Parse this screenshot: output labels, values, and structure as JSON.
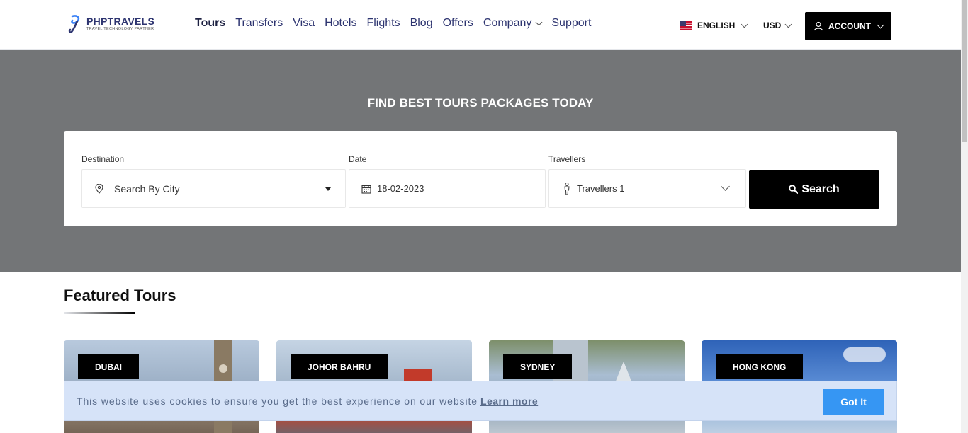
{
  "header": {
    "logo": {
      "name": "PHPTRAVELS",
      "tagline": "Travel Technology Partner"
    },
    "nav": [
      {
        "label": "Tours",
        "active": true
      },
      {
        "label": "Transfers"
      },
      {
        "label": "Visa"
      },
      {
        "label": "Hotels"
      },
      {
        "label": "Flights"
      },
      {
        "label": "Blog"
      },
      {
        "label": "Offers"
      },
      {
        "label": "Company",
        "dropdown": true
      },
      {
        "label": "Support"
      }
    ],
    "language": "ENGLISH",
    "currency": "USD",
    "account_label": "ACCOUNT"
  },
  "hero": {
    "title": "FIND BEST TOURS PACKAGES TODAY",
    "search": {
      "destination_label": "Destination",
      "destination_placeholder": "Search By City",
      "date_label": "Date",
      "date_value": "18-02-2023",
      "travellers_label": "Travellers",
      "travellers_value": "Travellers 1",
      "search_label": "Search"
    }
  },
  "featured": {
    "title": "Featured Tours",
    "tours": [
      {
        "label": "DUBAI"
      },
      {
        "label": "JOHOR BAHRU"
      },
      {
        "label": "SYDNEY"
      },
      {
        "label": "HONG KONG"
      }
    ]
  },
  "cookie": {
    "text": "This website uses cookies to ensure you get the best experience on our website",
    "link": "Learn more",
    "button": "Got It"
  },
  "colors": {
    "hero_bg": "#737577",
    "primary_dark": "#000000",
    "cookie_bg": "#d6e3f8",
    "cookie_button": "#3696f3",
    "nav_text": "#2d3470"
  }
}
